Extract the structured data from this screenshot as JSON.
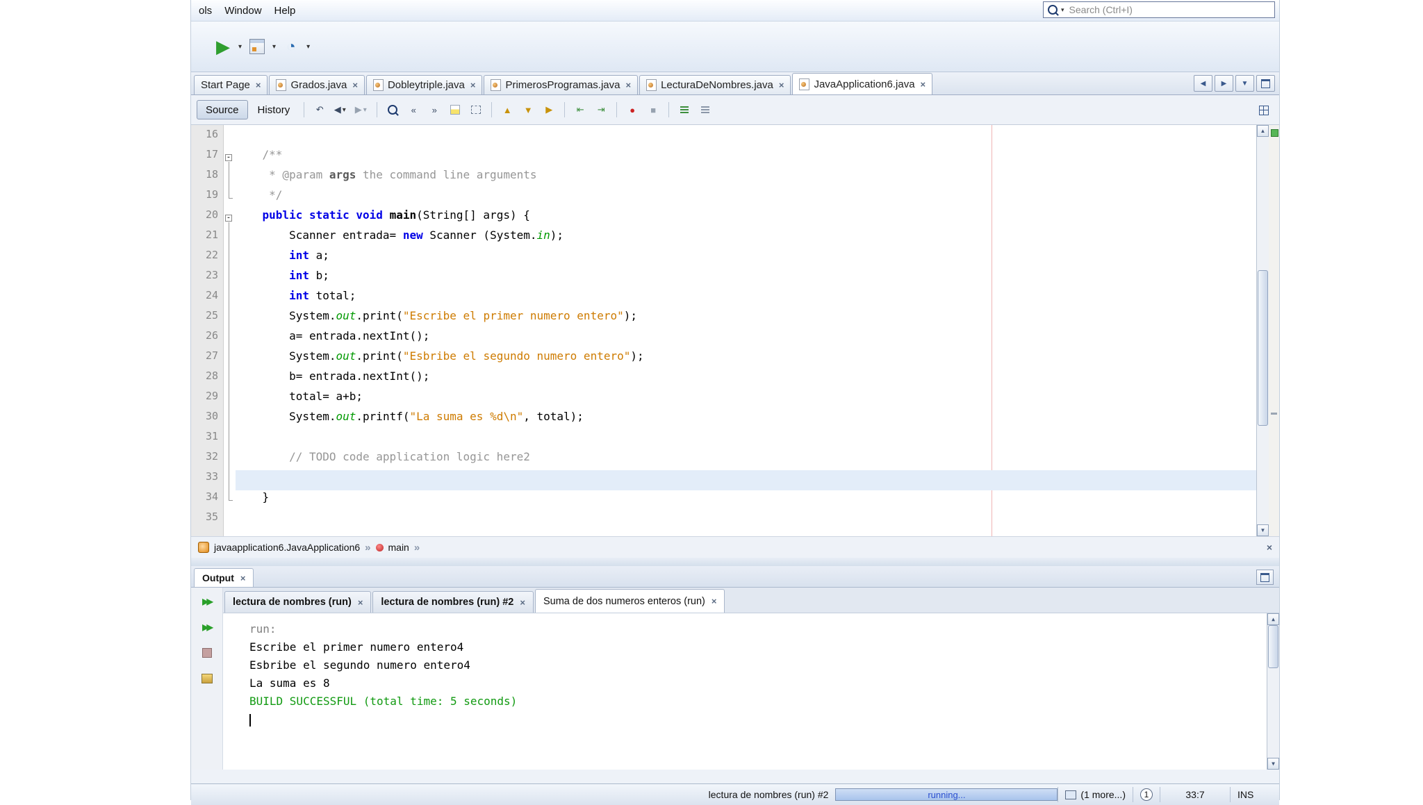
{
  "menu": {
    "items": [
      "ols",
      "Window",
      "Help"
    ]
  },
  "search": {
    "placeholder": "Search (Ctrl+I)"
  },
  "icons": {
    "run": "▶",
    "caret": "▾",
    "close": "×",
    "chevron": "»",
    "left": "◀",
    "right": "▶",
    "up": "▲",
    "down": "▼",
    "last_edit": "↶",
    "prev": "«",
    "next": "»",
    "shift_left": "⇤",
    "shift_right": "⇥",
    "record": "●",
    "square": "■",
    "rerun": "▶▶"
  },
  "editor_tabs": [
    {
      "label": "Start Page",
      "file": false,
      "active": false
    },
    {
      "label": "Grados.java",
      "file": true,
      "active": false
    },
    {
      "label": "Dobleytriple.java",
      "file": true,
      "active": false
    },
    {
      "label": "PrimerosProgramas.java",
      "file": true,
      "active": false
    },
    {
      "label": "LecturaDeNombres.java",
      "file": true,
      "active": false
    },
    {
      "label": "JavaApplication6.java",
      "file": true,
      "active": true
    }
  ],
  "editor_toolbar": {
    "source": "Source",
    "history": "History"
  },
  "code": {
    "lines": [
      {
        "n": 16,
        "fold": "",
        "hl": false,
        "seg": []
      },
      {
        "n": 17,
        "fold": "start",
        "hl": false,
        "seg": [
          [
            "c",
            "    /**"
          ]
        ]
      },
      {
        "n": 18,
        "fold": "mid",
        "hl": false,
        "seg": [
          [
            "c",
            "     * @param "
          ],
          [
            "cb",
            "args"
          ],
          [
            "c",
            " the command line arguments"
          ]
        ]
      },
      {
        "n": 19,
        "fold": "end",
        "hl": false,
        "seg": [
          [
            "c",
            "     */"
          ]
        ]
      },
      {
        "n": 20,
        "fold": "start",
        "hl": false,
        "seg": [
          [
            "k",
            "    public static void "
          ],
          [
            "m",
            "main"
          ],
          [
            "p",
            "(String[] args) {"
          ]
        ]
      },
      {
        "n": 21,
        "fold": "mid",
        "hl": false,
        "seg": [
          [
            "p",
            "        Scanner entrada= "
          ],
          [
            "k",
            "new"
          ],
          [
            "p",
            " Scanner (System."
          ],
          [
            "f",
            "in"
          ],
          [
            "p",
            ");"
          ]
        ]
      },
      {
        "n": 22,
        "fold": "mid",
        "hl": false,
        "seg": [
          [
            "k",
            "        int"
          ],
          [
            "p",
            " a;"
          ]
        ]
      },
      {
        "n": 23,
        "fold": "mid",
        "hl": false,
        "seg": [
          [
            "k",
            "        int"
          ],
          [
            "p",
            " b;"
          ]
        ]
      },
      {
        "n": 24,
        "fold": "mid",
        "hl": false,
        "seg": [
          [
            "k",
            "        int"
          ],
          [
            "p",
            " total;"
          ]
        ]
      },
      {
        "n": 25,
        "fold": "mid",
        "hl": false,
        "seg": [
          [
            "p",
            "        System."
          ],
          [
            "f",
            "out"
          ],
          [
            "p",
            ".print("
          ],
          [
            "s",
            "\"Escribe el primer numero entero\""
          ],
          [
            "p",
            ");"
          ]
        ]
      },
      {
        "n": 26,
        "fold": "mid",
        "hl": false,
        "seg": [
          [
            "p",
            "        a= entrada.nextInt();"
          ]
        ]
      },
      {
        "n": 27,
        "fold": "mid",
        "hl": false,
        "seg": [
          [
            "p",
            "        System."
          ],
          [
            "f",
            "out"
          ],
          [
            "p",
            ".print("
          ],
          [
            "s",
            "\"Esbribe el segundo numero entero\""
          ],
          [
            "p",
            ");"
          ]
        ]
      },
      {
        "n": 28,
        "fold": "mid",
        "hl": false,
        "seg": [
          [
            "p",
            "        b= entrada.nextInt();"
          ]
        ]
      },
      {
        "n": 29,
        "fold": "mid",
        "hl": false,
        "seg": [
          [
            "p",
            "        total= a+b;"
          ]
        ]
      },
      {
        "n": 30,
        "fold": "mid",
        "hl": false,
        "seg": [
          [
            "p",
            "        System."
          ],
          [
            "f",
            "out"
          ],
          [
            "p",
            ".printf("
          ],
          [
            "s",
            "\"La suma es %d\\n\""
          ],
          [
            "p",
            ", total);"
          ]
        ]
      },
      {
        "n": 31,
        "fold": "mid",
        "hl": false,
        "seg": []
      },
      {
        "n": 32,
        "fold": "mid",
        "hl": false,
        "seg": [
          [
            "c",
            "        // TODO code application logic here2"
          ]
        ]
      },
      {
        "n": 33,
        "fold": "mid",
        "hl": true,
        "seg": []
      },
      {
        "n": 34,
        "fold": "end",
        "hl": false,
        "seg": [
          [
            "p",
            "    }"
          ]
        ]
      },
      {
        "n": 35,
        "fold": "",
        "hl": false,
        "seg": []
      }
    ]
  },
  "breadcrumb": {
    "class_name": "javaapplication6.JavaApplication6",
    "member": "main"
  },
  "output": {
    "panel_label": "Output",
    "tabs": [
      {
        "label": "lectura de nombres (run)",
        "bold": true,
        "active": false
      },
      {
        "label": "lectura de nombres (run) #2",
        "bold": true,
        "active": false
      },
      {
        "label": "Suma de dos numeros enteros (run)",
        "bold": false,
        "active": true
      }
    ],
    "lines": [
      {
        "cls": "dim",
        "text": "run:"
      },
      {
        "cls": "plain",
        "text": "Escribe el primer numero entero4"
      },
      {
        "cls": "plain",
        "text": "Esbribe el segundo numero entero4"
      },
      {
        "cls": "plain",
        "text": "La suma es 8"
      },
      {
        "cls": "success",
        "text": "BUILD SUCCESSFUL (total time: 5 seconds)"
      },
      {
        "cls": "caret",
        "text": ""
      }
    ]
  },
  "status": {
    "process": "lectura de nombres (run) #2",
    "progress": "running...",
    "more": "(1 more...)",
    "badge": "1",
    "caret_position": "33:7",
    "mode": "INS"
  }
}
